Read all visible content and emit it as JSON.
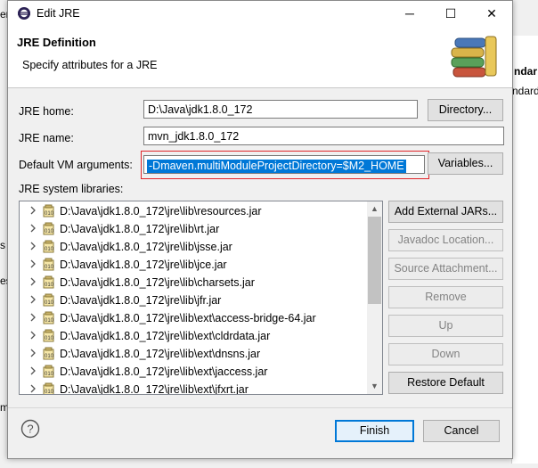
{
  "background": {
    "left_fragments": [
      "er",
      "s",
      "es",
      "m"
    ],
    "right_fragments": [
      "ndar",
      "ndard"
    ]
  },
  "window": {
    "title": "Edit JRE",
    "controls": {
      "minimize": "─",
      "maximize": "☐",
      "close": "✕"
    }
  },
  "header": {
    "title": "JRE Definition",
    "description": "Specify attributes for a JRE"
  },
  "form": {
    "jre_home_label": "JRE home:",
    "jre_home_value": "D:\\Java\\jdk1.8.0_172",
    "directory_button": "Directory...",
    "jre_name_label": "JRE name:",
    "jre_name_value": "mvn_jdk1.8.0_172",
    "vm_args_label": "Default VM arguments:",
    "vm_args_value": "-Dmaven.multiModuleProjectDirectory=$M2_HOME",
    "variables_button": "Variables...",
    "libraries_label": "JRE system libraries:"
  },
  "libraries": [
    "D:\\Java\\jdk1.8.0_172\\jre\\lib\\resources.jar",
    "D:\\Java\\jdk1.8.0_172\\jre\\lib\\rt.jar",
    "D:\\Java\\jdk1.8.0_172\\jre\\lib\\jsse.jar",
    "D:\\Java\\jdk1.8.0_172\\jre\\lib\\jce.jar",
    "D:\\Java\\jdk1.8.0_172\\jre\\lib\\charsets.jar",
    "D:\\Java\\jdk1.8.0_172\\jre\\lib\\jfr.jar",
    "D:\\Java\\jdk1.8.0_172\\jre\\lib\\ext\\access-bridge-64.jar",
    "D:\\Java\\jdk1.8.0_172\\jre\\lib\\ext\\cldrdata.jar",
    "D:\\Java\\jdk1.8.0_172\\jre\\lib\\ext\\dnsns.jar",
    "D:\\Java\\jdk1.8.0_172\\jre\\lib\\ext\\jaccess.jar",
    "D:\\Java\\jdk1.8.0_172\\jre\\lib\\ext\\jfxrt.jar"
  ],
  "side_buttons": {
    "add_external": "Add External JARs...",
    "javadoc": "Javadoc Location...",
    "source": "Source Attachment...",
    "remove": "Remove",
    "up": "Up",
    "down": "Down",
    "restore": "Restore Default"
  },
  "footer": {
    "finish": "Finish",
    "cancel": "Cancel"
  },
  "colors": {
    "selection": "#0078d7",
    "highlight_box": "#e0262a"
  }
}
